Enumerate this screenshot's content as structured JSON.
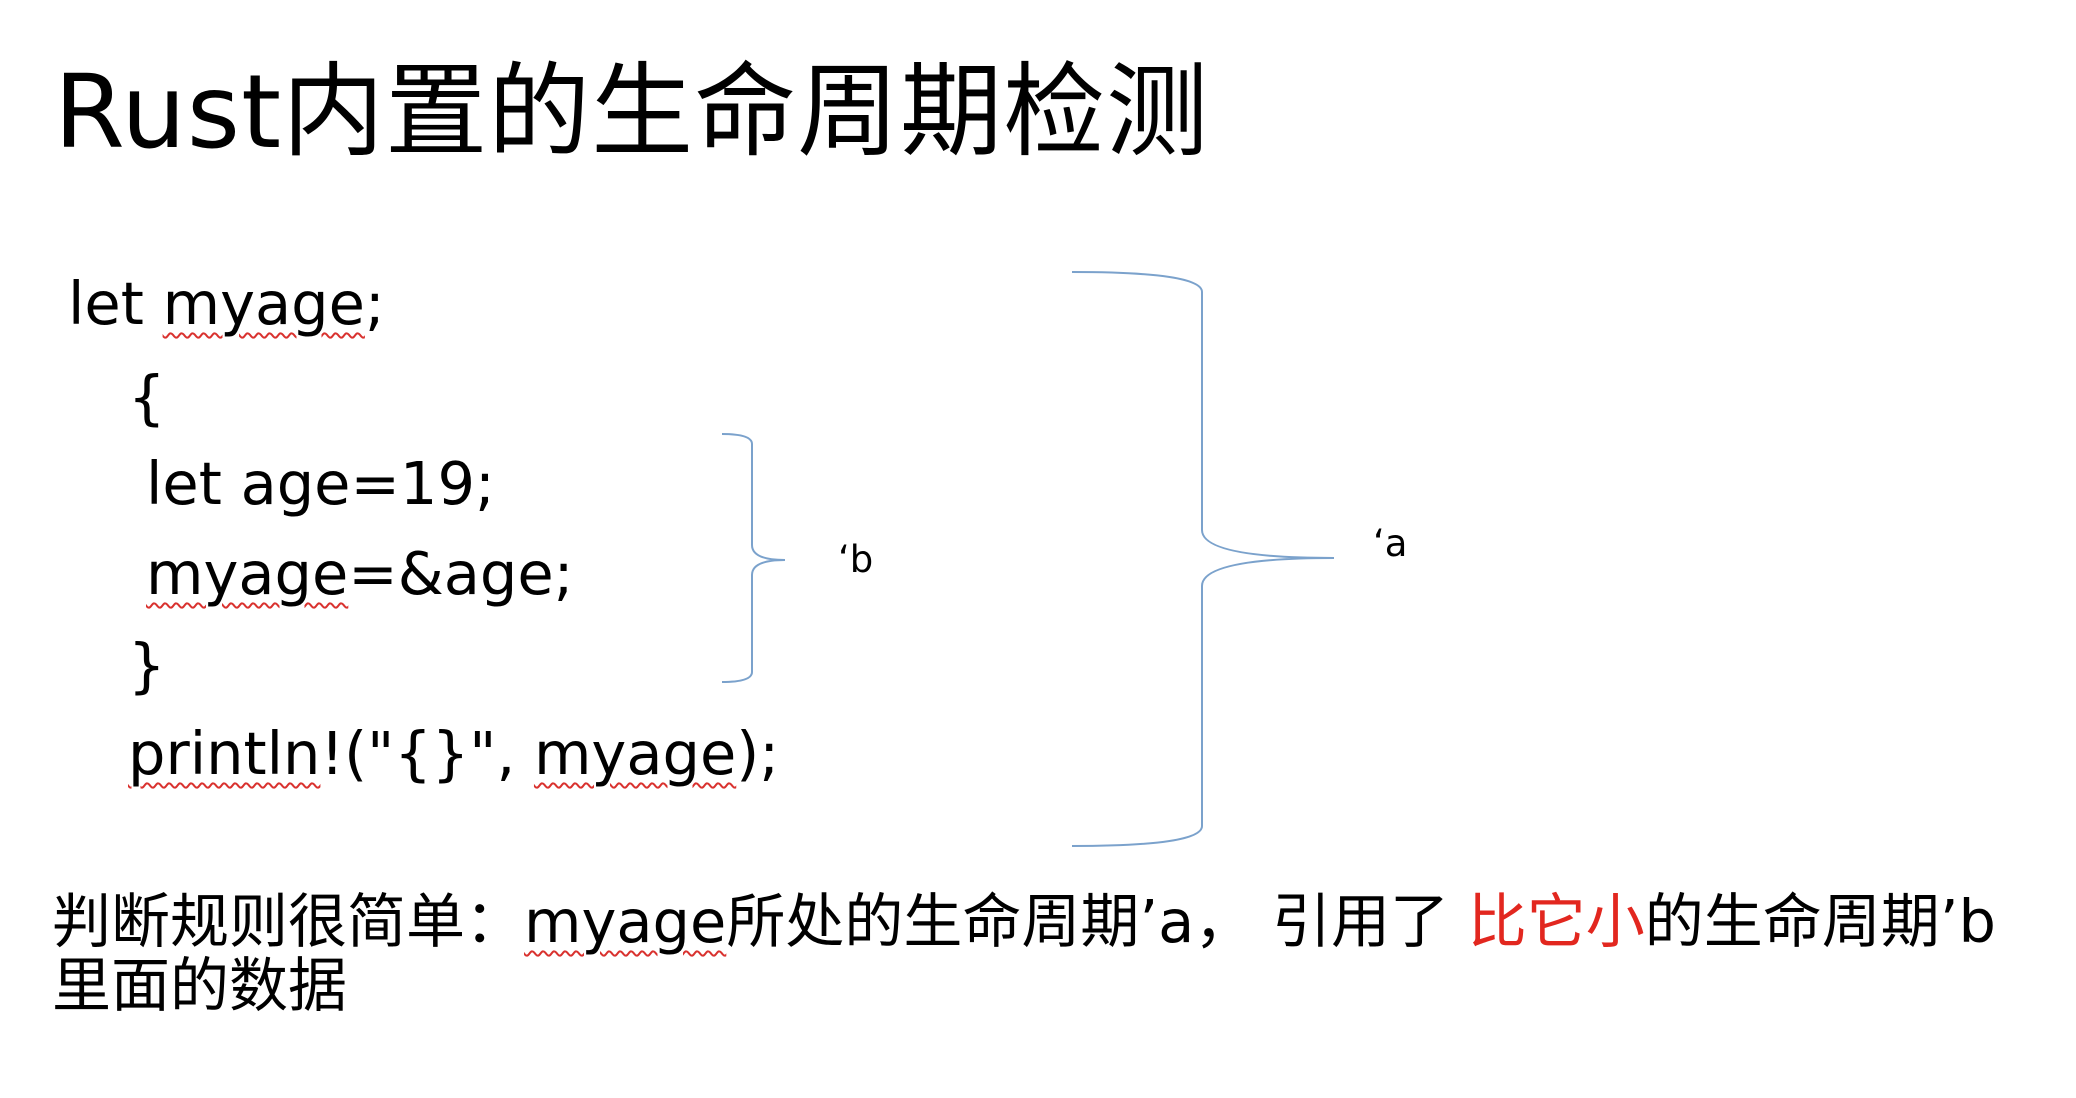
{
  "slide": {
    "title": "Rust内置的生命周期检测",
    "code": {
      "line1_prefix": "let ",
      "line1_var": "myage",
      "line1_suffix": ";",
      "line2": "{",
      "line3": "let age=19;",
      "line4_var": "myage",
      "line4_suffix": "=&age;",
      "line5": "}",
      "line6_fn": "println",
      "line6_mid": "!(\"{}\", ",
      "line6_var": "myage",
      "line6_suffix": ");"
    },
    "lifetimes": {
      "inner_label": "‘b",
      "outer_label": "‘a"
    },
    "summary": {
      "part1": "判断规则很简单：",
      "var": "myage",
      "part2": "所处的生命周期’a， 引用了 ",
      "highlight": "比它小",
      "part3": "的生命周期’b 里面的数据"
    },
    "colors": {
      "brace": "#7ba2cc",
      "highlight": "#e2271f",
      "spellcheck": "#d9322f"
    }
  }
}
